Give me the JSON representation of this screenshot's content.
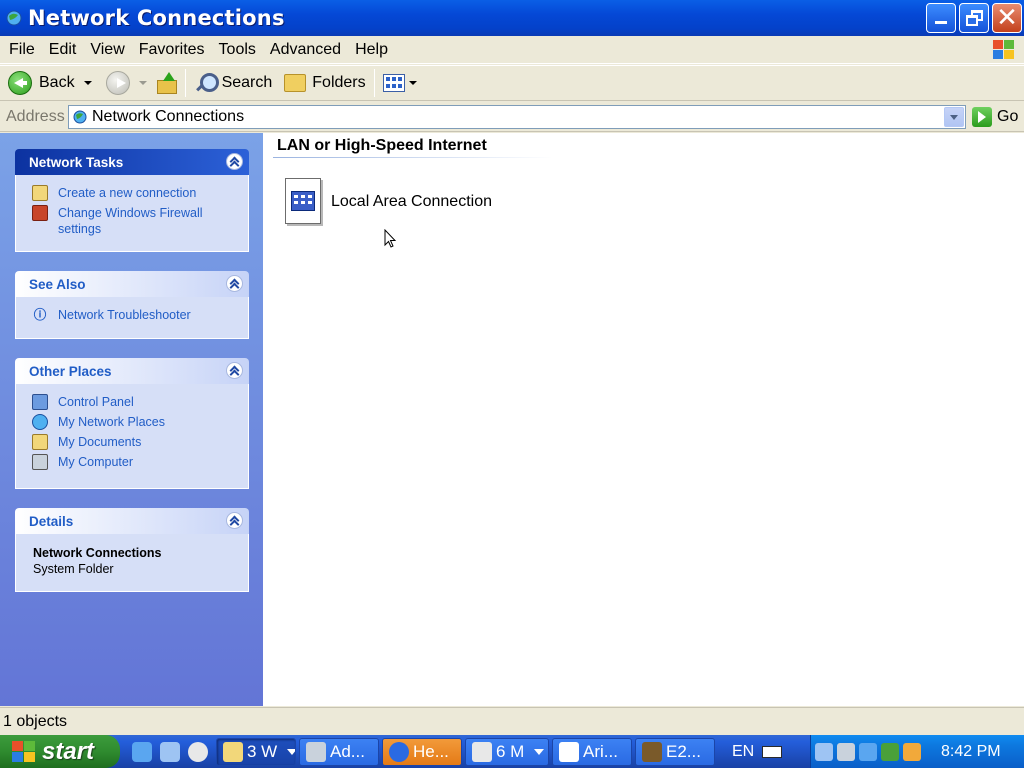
{
  "window": {
    "title": "Network Connections"
  },
  "menu": [
    "File",
    "Edit",
    "View",
    "Favorites",
    "Tools",
    "Advanced",
    "Help"
  ],
  "toolbar": {
    "back_label": "Back",
    "search_label": "Search",
    "folders_label": "Folders"
  },
  "address": {
    "label": "Address",
    "value": "Network Connections",
    "go_label": "Go"
  },
  "taskpane": {
    "network_tasks": {
      "title": "Network Tasks",
      "items": [
        "Create a new connection",
        "Change Windows Firewall settings"
      ]
    },
    "see_also": {
      "title": "See Also",
      "items": [
        "Network Troubleshooter"
      ]
    },
    "other_places": {
      "title": "Other Places",
      "items": [
        "Control Panel",
        "My Network Places",
        "My Documents",
        "My Computer"
      ]
    },
    "details": {
      "title": "Details",
      "name": "Network Connections",
      "type": "System Folder"
    }
  },
  "content": {
    "group_title": "LAN or High-Speed Internet",
    "items": [
      {
        "label": "Local Area Connection"
      }
    ]
  },
  "status": {
    "text": "1 objects"
  },
  "taskbar": {
    "start_label": "start",
    "buttons": [
      "3 W",
      "Ad...",
      "He...",
      "6 M",
      "Ari...",
      "E2..."
    ],
    "language": "EN",
    "clock": "8:42 PM"
  }
}
